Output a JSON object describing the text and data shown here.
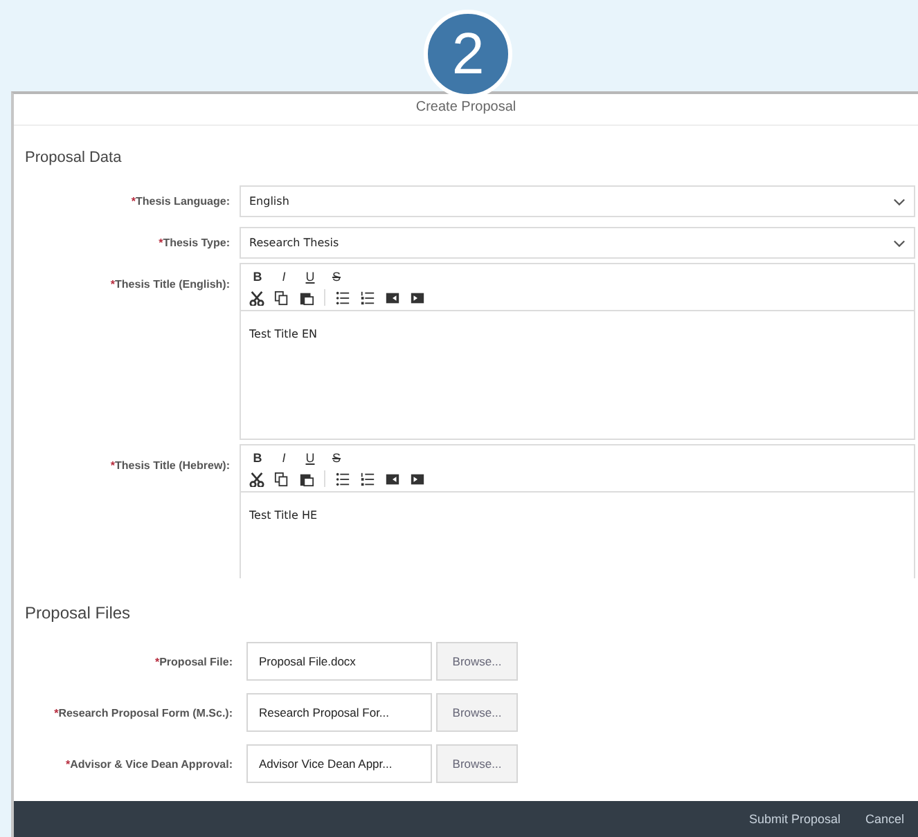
{
  "step_badge": "2",
  "dialog": {
    "title": "Create Proposal"
  },
  "proposal_data": {
    "heading": "Proposal Data",
    "fields": [
      {
        "kind": "select",
        "mark": "*",
        "label": "Thesis Language:",
        "value": "English"
      },
      {
        "kind": "select",
        "mark": "*",
        "label": "Thesis Type:",
        "value": "Research Thesis"
      },
      {
        "kind": "editor",
        "mark": "*",
        "label": "Thesis Title (English):",
        "format_buttons": [
          "B",
          "I",
          "U",
          "S"
        ],
        "value": "Test Title EN"
      },
      {
        "kind": "editor",
        "mark": "*",
        "label": "Thesis Title (Hebrew):",
        "format_buttons": [
          "B",
          "I",
          "U",
          "S"
        ],
        "value": "Test Title HE"
      }
    ]
  },
  "proposal_files": {
    "heading": "Proposal Files",
    "files": [
      {
        "mark": "*",
        "label": "Proposal File:",
        "value": "Proposal File.docx",
        "button": "Browse..."
      },
      {
        "mark": "*",
        "label": "Research Proposal Form (M.Sc.):",
        "value": "Research Proposal For...",
        "button": "Browse..."
      },
      {
        "mark": "*",
        "label": "Advisor & Vice Dean Approval:",
        "value": "Advisor Vice Dean Appr...",
        "button": "Browse..."
      }
    ]
  },
  "footer": {
    "buttons": [
      "Submit Proposal",
      "Cancel"
    ]
  }
}
